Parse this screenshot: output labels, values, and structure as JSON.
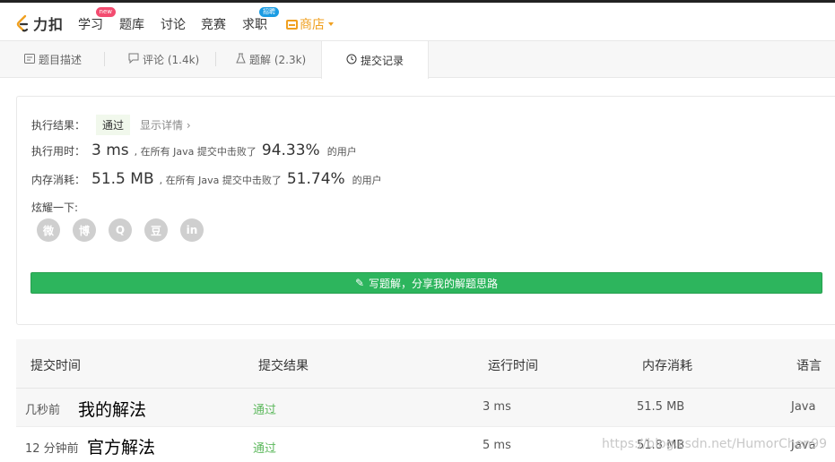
{
  "nav": {
    "logo_text": "力扣",
    "items": [
      {
        "label": "学习",
        "badge": "new"
      },
      {
        "label": "题库"
      },
      {
        "label": "讨论"
      },
      {
        "label": "竞赛"
      },
      {
        "label": "求职",
        "badge": "招聘"
      },
      {
        "label": "商店"
      }
    ]
  },
  "tabs": [
    {
      "label": "题目描述",
      "icon": "description-icon"
    },
    {
      "label": "评论 (1.4k)",
      "icon": "comment-icon"
    },
    {
      "label": "题解 (2.3k)",
      "icon": "flask-icon"
    },
    {
      "label": "提交记录",
      "icon": "clock-icon",
      "active": true
    }
  ],
  "result": {
    "status_label": "执行结果：",
    "status": "通过",
    "detail_link": "显示详情 ›",
    "time_label": "执行用时：",
    "time_value": "3 ms",
    "time_text": ", 在所有 Java 提交中击败了",
    "time_pct": "94.33%",
    "users_text": "的用户",
    "mem_label": "内存消耗：",
    "mem_value": "51.5 MB",
    "mem_text": ", 在所有 Java 提交中击败了",
    "mem_pct": "51.74%",
    "share_label": "炫耀一下:",
    "share_icons": [
      "wechat-icon",
      "weibo-icon",
      "qq-icon",
      "douban-icon",
      "linkedin-icon"
    ],
    "share_glyphs": [
      "微",
      "博",
      "Q",
      "豆",
      "in"
    ],
    "write_button": "写题解，分享我的解题思路"
  },
  "table": {
    "headers": [
      "提交时间",
      "提交结果",
      "运行时间",
      "内存消耗",
      "语言"
    ],
    "rows": [
      {
        "time": "几秒前",
        "note": "我的解法",
        "result": "通过",
        "runtime": "3 ms",
        "memory": "51.5 MB",
        "lang": "Java"
      },
      {
        "time": "12 分钟前",
        "note": "官方解法",
        "result": "通过",
        "runtime": "5 ms",
        "memory": "51.8 MB",
        "lang": "Java"
      }
    ]
  },
  "watermark": "https://blog.csdn.net/HumorChen99",
  "colors": {
    "accent_green": "#2db55d",
    "pass_green": "#5cb85c",
    "store_orange": "#f0a020",
    "new_badge": "#f34c70",
    "hire_badge": "#1a9ce3"
  }
}
